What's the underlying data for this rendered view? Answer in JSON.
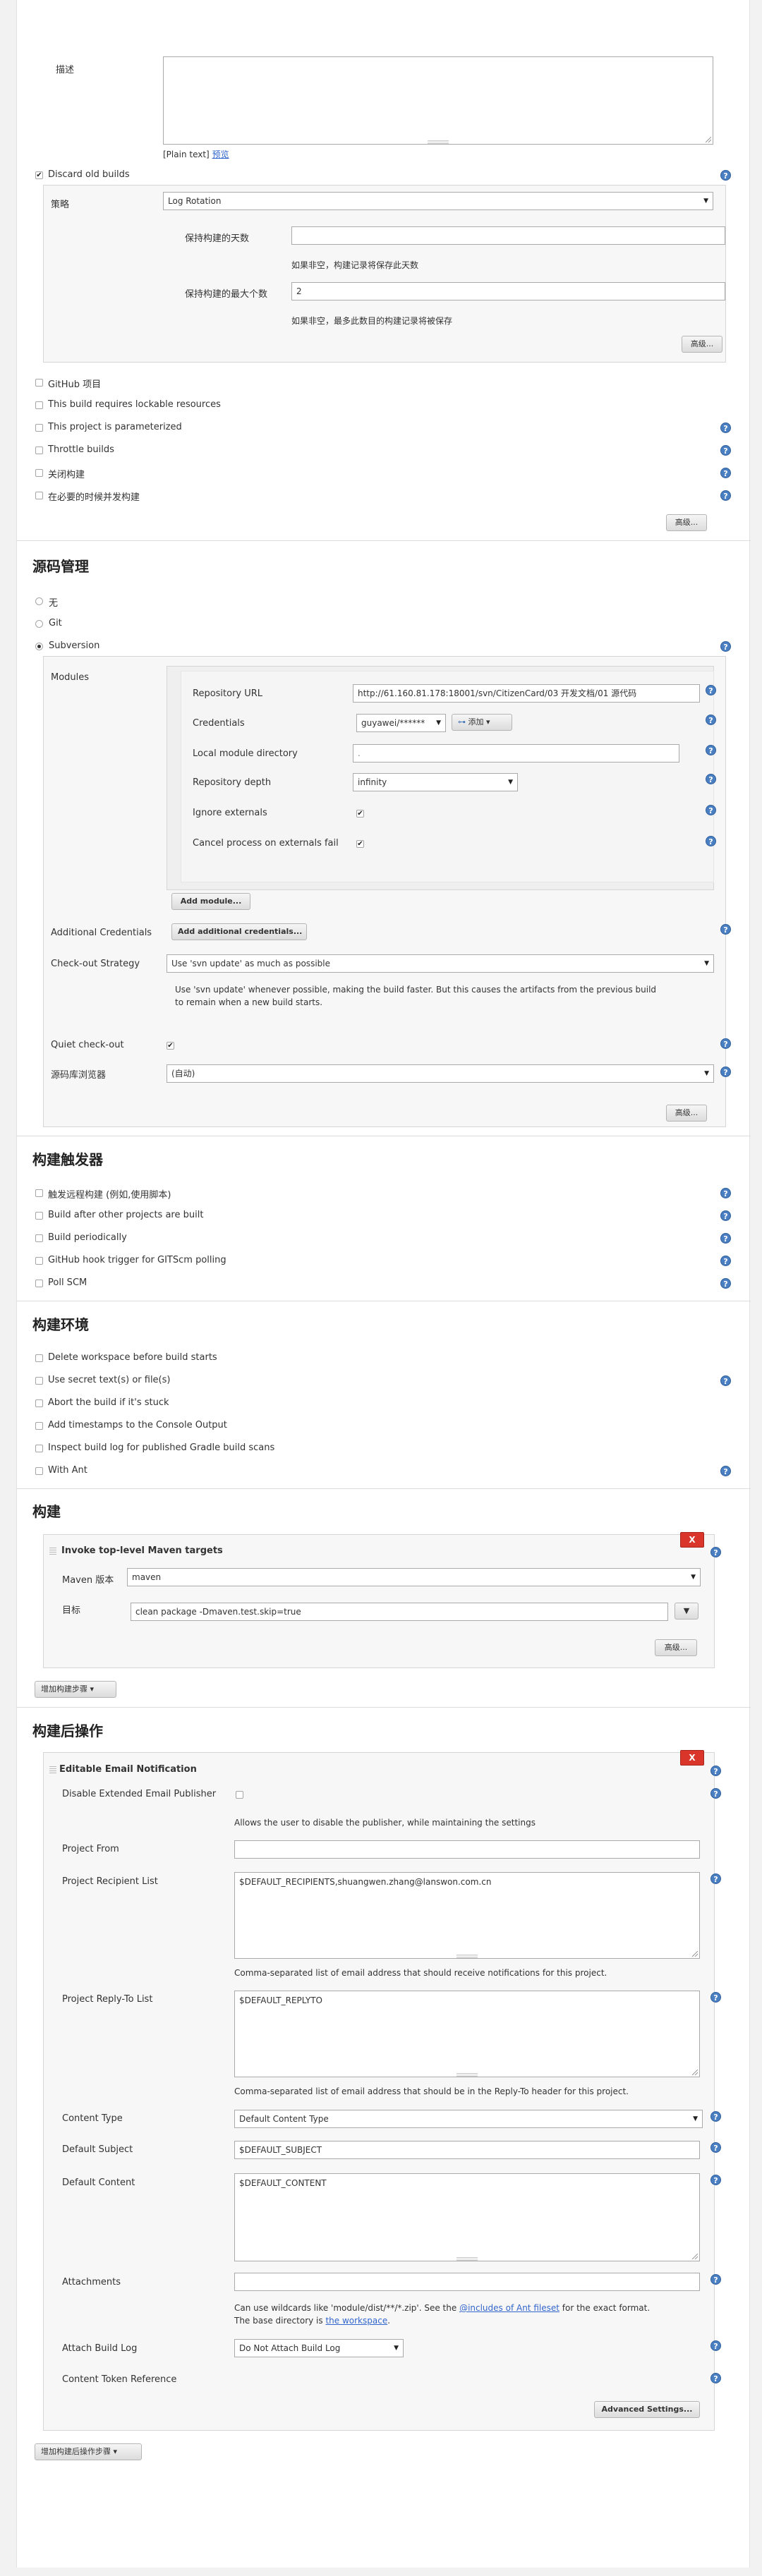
{
  "top": {
    "description_label": "描述",
    "plain_text": "[Plain text]",
    "preview": "预览"
  },
  "discard": {
    "label": "Discard old builds",
    "strategy_label": "策略",
    "strategy_value": "Log Rotation",
    "days_label": "保持构建的天数",
    "days_value": "",
    "days_help": "如果非空，构建记录将保存此天数",
    "max_label": "保持构建的最大个数",
    "max_value": "2",
    "max_help": "如果非空，最多此数目的构建记录将被保存",
    "advanced": "高级..."
  },
  "general_options": [
    {
      "label": "GitHub 项目",
      "help": false
    },
    {
      "label": "This build requires lockable resources",
      "help": false
    },
    {
      "label": "This project is parameterized",
      "help": true
    },
    {
      "label": "Throttle builds",
      "help": true
    },
    {
      "label": "关闭构建",
      "help": true
    },
    {
      "label": "在必要的时候并发构建",
      "help": true
    }
  ],
  "general_advanced": "高级...",
  "scm": {
    "title": "源码管理",
    "options": [
      "无",
      "Git",
      "Subversion"
    ],
    "modules_label": "Modules",
    "repo_url_label": "Repository URL",
    "repo_url_value": "http://61.160.81.178:18001/svn/CitizenCard/03 开发文档/01 源代码",
    "credentials_label": "Credentials",
    "credentials_value": "guyawei/******",
    "add_label": "添加",
    "local_dir_label": "Local module directory",
    "local_dir_value": ".",
    "depth_label": "Repository depth",
    "depth_value": "infinity",
    "ignore_label": "Ignore externals",
    "cancel_label": "Cancel process on externals fail",
    "add_module": "Add module...",
    "additional_label": "Additional Credentials",
    "additional_btn": "Add additional credentials...",
    "checkout_label": "Check-out Strategy",
    "checkout_value": "Use 'svn update' as much as possible",
    "checkout_desc1": "Use 'svn update' whenever possible, making the build faster. But this causes the artifacts from the previous build",
    "checkout_desc2": "to remain when a new build starts.",
    "quiet_label": "Quiet check-out",
    "browser_label": "源码库浏览器",
    "browser_value": "(自动)",
    "advanced": "高级..."
  },
  "triggers": {
    "title": "构建触发器",
    "items": [
      "触发远程构建 (例如,使用脚本)",
      "Build after other projects are built",
      "Build periodically",
      "GitHub hook trigger for GITScm polling",
      "Poll SCM"
    ]
  },
  "env": {
    "title": "构建环境",
    "items": [
      {
        "label": "Delete workspace before build starts",
        "help": false
      },
      {
        "label": "Use secret text(s) or file(s)",
        "help": true
      },
      {
        "label": "Abort the build if it's stuck",
        "help": false
      },
      {
        "label": "Add timestamps to the Console Output",
        "help": false
      },
      {
        "label": "Inspect build log for published Gradle build scans",
        "help": false
      },
      {
        "label": "With Ant",
        "help": true
      }
    ]
  },
  "build": {
    "title": "构建",
    "step_title": "Invoke top-level Maven targets",
    "maven_label": "Maven 版本",
    "maven_value": "maven",
    "goals_label": "目标",
    "goals_value": "clean package -Dmaven.test.skip=true",
    "advanced": "高级...",
    "add_step": "增加构建步骤",
    "delete": "X"
  },
  "post": {
    "title": "构建后操作",
    "step_title": "Editable Email Notification",
    "delete": "X",
    "disable_label": "Disable Extended Email Publisher",
    "disable_desc": "Allows the user to disable the publisher, while maintaining the settings",
    "from_label": "Project From",
    "from_value": "",
    "recipient_label": "Project Recipient List",
    "recipient_value": "$DEFAULT_RECIPIENTS,shuangwen.zhang@lanswon.com.cn",
    "recipient_desc": "Comma-separated list of email address that should receive notifications for this project.",
    "replyto_label": "Project Reply-To List",
    "replyto_value": "$DEFAULT_REPLYTO",
    "replyto_desc": "Comma-separated list of email address that should be in the Reply-To header for this project.",
    "content_type_label": "Content Type",
    "content_type_value": "Default Content Type",
    "subject_label": "Default Subject",
    "subject_value": "$DEFAULT_SUBJECT",
    "content_label": "Default Content",
    "content_value": "$DEFAULT_CONTENT",
    "attachments_label": "Attachments",
    "attachments_value": "",
    "attach_desc_a": "Can use wildcards like 'module/dist/**/*.zip'. See the ",
    "attach_desc_link": "@includes of Ant fileset",
    "attach_desc_b": " for the exact format.",
    "attach_desc_c": "The base directory is ",
    "attach_desc_link2": "the workspace",
    "attach_desc_d": ".",
    "attach_log_label": "Attach Build Log",
    "attach_log_value": "Do Not Attach Build Log",
    "token_label": "Content Token Reference",
    "advanced_settings": "Advanced Settings...",
    "add_post_step": "增加构建后操作步骤"
  }
}
